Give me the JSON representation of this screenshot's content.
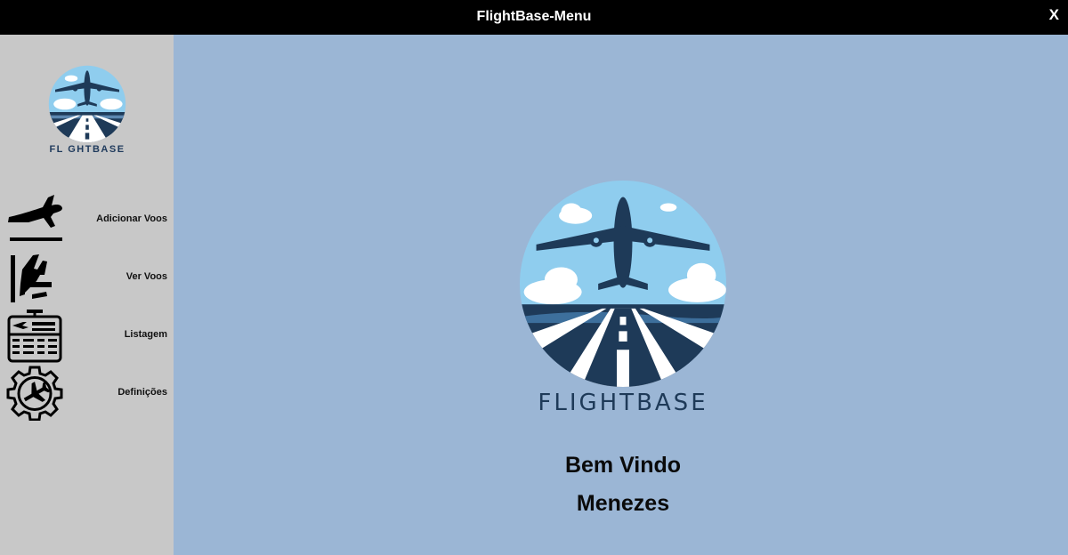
{
  "window": {
    "title": "FlightBase-Menu",
    "close_label": "X"
  },
  "sidebar": {
    "logo_text": "FL GHTBASE",
    "items": [
      {
        "label": "Adicionar Voos",
        "icon": "departing-plane-icon"
      },
      {
        "label": "Ver Voos",
        "icon": "landing-plane-icon"
      },
      {
        "label": "Listagem",
        "icon": "departures-board-icon"
      },
      {
        "label": "Definições",
        "icon": "gear-plane-icon"
      }
    ]
  },
  "main": {
    "logo_text": "FLIGHTBASE",
    "welcome": "Bem Vindo",
    "username": "Menezes"
  },
  "colors": {
    "titlebar": "#000000",
    "sidebar": "#c8c8c8",
    "main_bg": "#9bb6d5",
    "logo_navy": "#1e3a58",
    "logo_sky": "#8fcdee"
  }
}
